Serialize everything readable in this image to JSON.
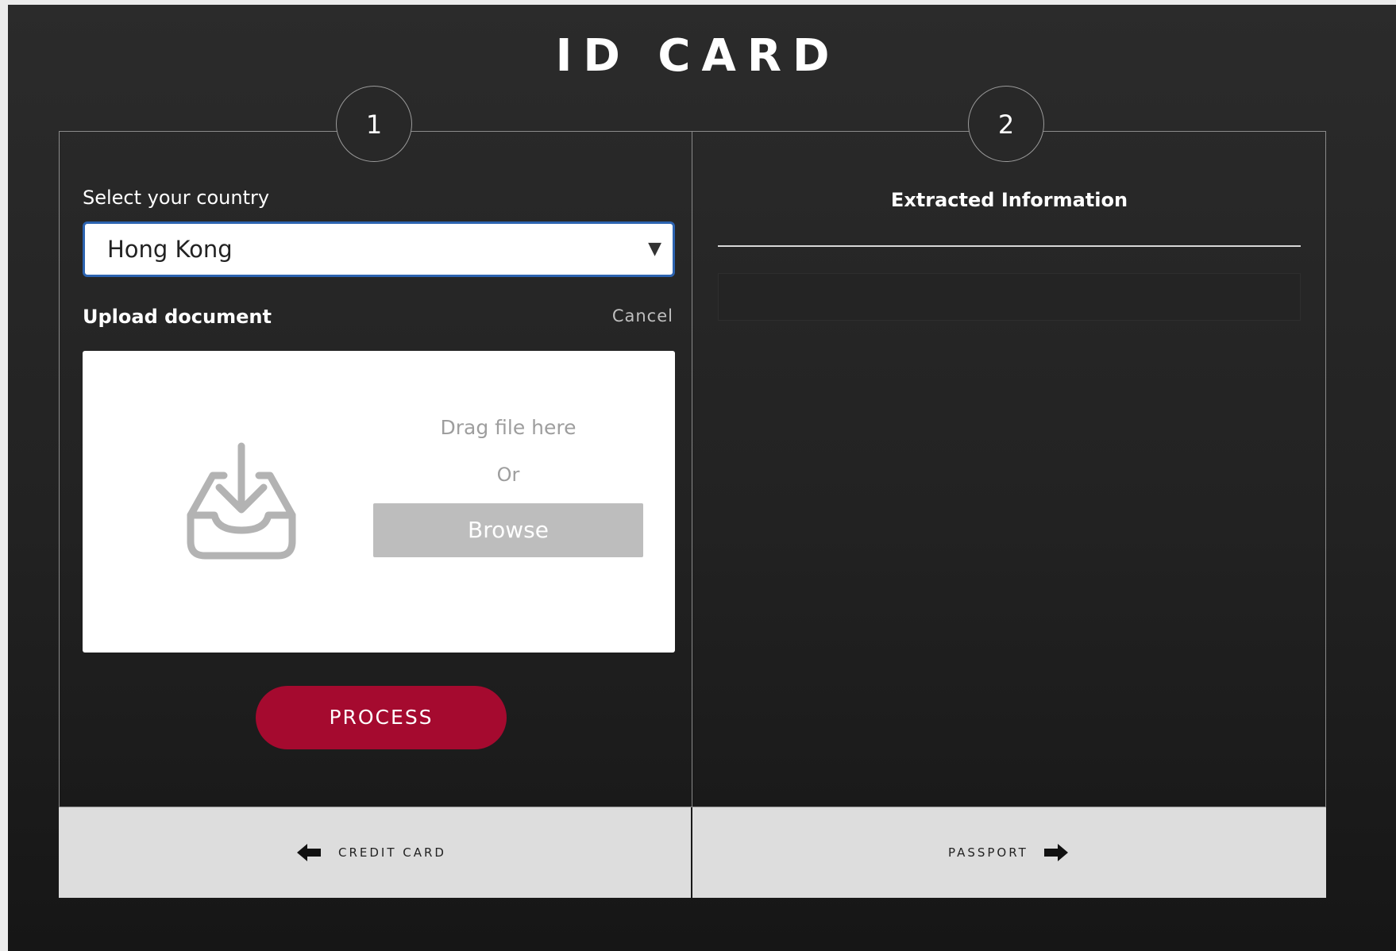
{
  "page": {
    "title": "ID CARD"
  },
  "steps": [
    {
      "number": "1"
    },
    {
      "number": "2"
    }
  ],
  "left_panel": {
    "country_label": "Select your country",
    "country_select": {
      "selected": "Hong Kong",
      "arrow": "▼"
    },
    "upload_label": "Upload document",
    "cancel_label": "Cancel",
    "drop_zone": {
      "icon": "inbox-download-icon",
      "drag_text": "Drag file here",
      "or_text": "Or",
      "browse_label": "Browse"
    },
    "process_label": "PROCESS"
  },
  "right_panel": {
    "title": "Extracted Information"
  },
  "navigation": {
    "prev": {
      "label": "CREDIT CARD",
      "icon": "arrow-left-icon"
    },
    "next": {
      "label": "PASSPORT",
      "icon": "arrow-right-icon"
    }
  },
  "colors": {
    "accent": "#a50a2f",
    "select_border": "#2c63b0",
    "browse_button": "#bdbdbd",
    "nav_background": "#dddddd"
  }
}
